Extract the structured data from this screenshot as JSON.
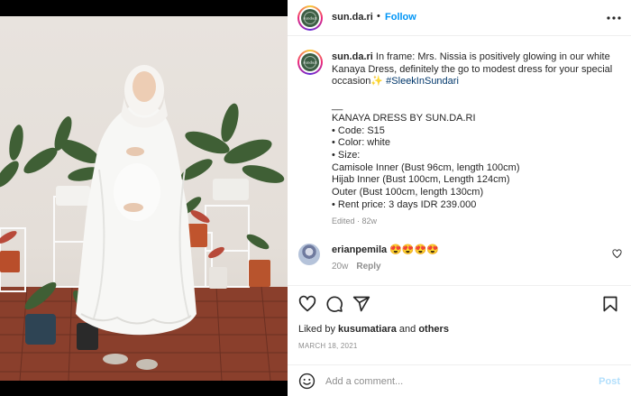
{
  "post": {
    "username": "sun.da.ri",
    "avatar_mark": "sundari",
    "follow_label": "Follow",
    "dot": "•",
    "more_icon": "more-horizontal-icon"
  },
  "caption": {
    "username": "sun.da.ri",
    "intro": " In frame: Mrs. Nissia is positively glowing in our white Kanaya Dress, definitely the go to modest dress for your special occasion✨ ",
    "hashtag": "#SleekInSundari",
    "dash": "__",
    "lines": [
      "KANAYA DRESS BY SUN.DA.RI",
      "• Code: S15",
      "• Color: white",
      "• Size:",
      "Camisole Inner (Bust 96cm, length 100cm)",
      "Hijab Inner (Bust 100cm, Length 124cm)",
      "Outer (Bust 100cm, length 130cm)",
      "• Rent price: 3 days IDR 239.000"
    ],
    "edited": "Edited · 82w"
  },
  "comment": {
    "username": "erianpemila",
    "text": " 😍😍😍😍",
    "age": "20w",
    "reply_label": "Reply"
  },
  "actions": {
    "icons": [
      "heart-icon",
      "comment-icon",
      "share-icon",
      "bookmark-icon"
    ],
    "liked_prefix": "Liked by ",
    "liked_user": "kusumatiara",
    "liked_mid": " and ",
    "liked_others": "others",
    "date": "MARCH 18, 2021"
  },
  "comment_box": {
    "placeholder": "Add a comment...",
    "post_label": "Post"
  },
  "colors": {
    "accent": "#0095f6",
    "post_disabled": "#b2dffc",
    "hashtag": "#00376b",
    "muted": "#8e8e8e"
  }
}
